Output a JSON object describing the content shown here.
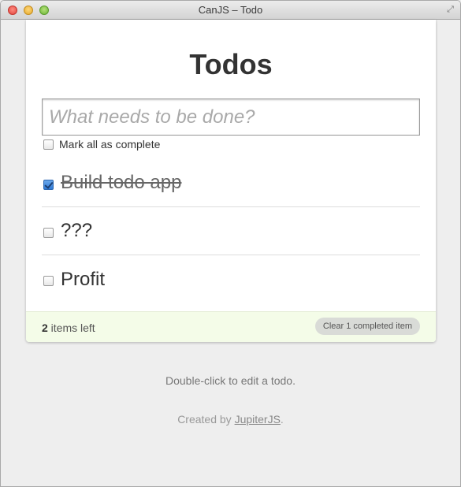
{
  "window": {
    "title": "CanJS – Todo"
  },
  "app": {
    "heading": "Todos",
    "new_todo_placeholder": "What needs to be done?",
    "toggle_all_label": "Mark all as complete",
    "todos": [
      {
        "label": "Build todo app",
        "completed": true
      },
      {
        "label": "???",
        "completed": false
      },
      {
        "label": "Profit",
        "completed": false
      }
    ],
    "footer": {
      "count": "2",
      "count_suffix": " items left",
      "clear_button": "Clear 1 completed item"
    }
  },
  "info": {
    "hint": "Double-click to edit a todo.",
    "credit_prefix": "Created by ",
    "credit_link": "JupiterJS",
    "credit_suffix": "."
  },
  "colors": {
    "footer_bg": "#f4fce8",
    "checkbox_checked": "#2f7ad6"
  }
}
